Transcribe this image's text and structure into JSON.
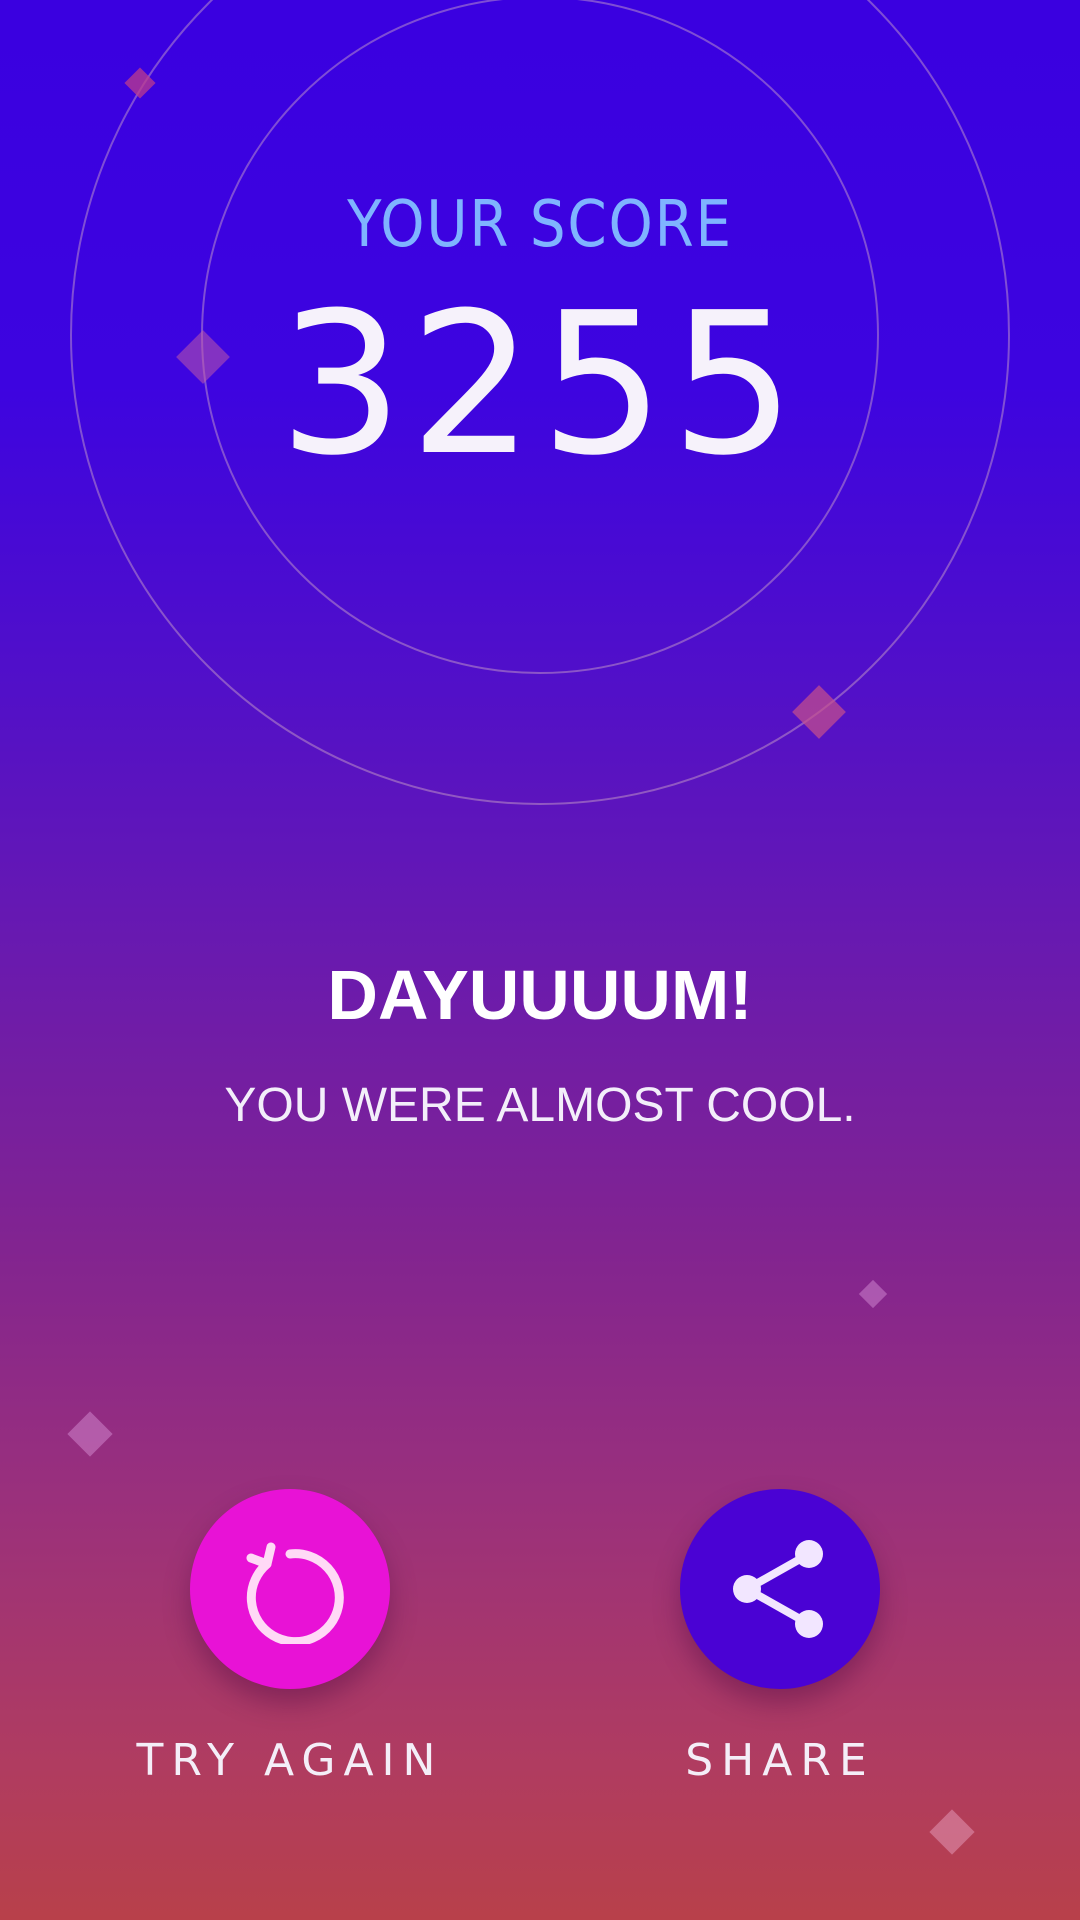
{
  "score": {
    "label": "YOUR SCORE",
    "value": "3255"
  },
  "message": {
    "headline": "DAYUUUUM!",
    "subline": "YOU WERE ALMOST COOL."
  },
  "actions": {
    "retry": {
      "label": "TRY AGAIN",
      "icon": "refresh-icon",
      "color": "#e812d6"
    },
    "share": {
      "label": "SHARE",
      "icon": "share-icon",
      "color": "#4a02d4"
    }
  }
}
